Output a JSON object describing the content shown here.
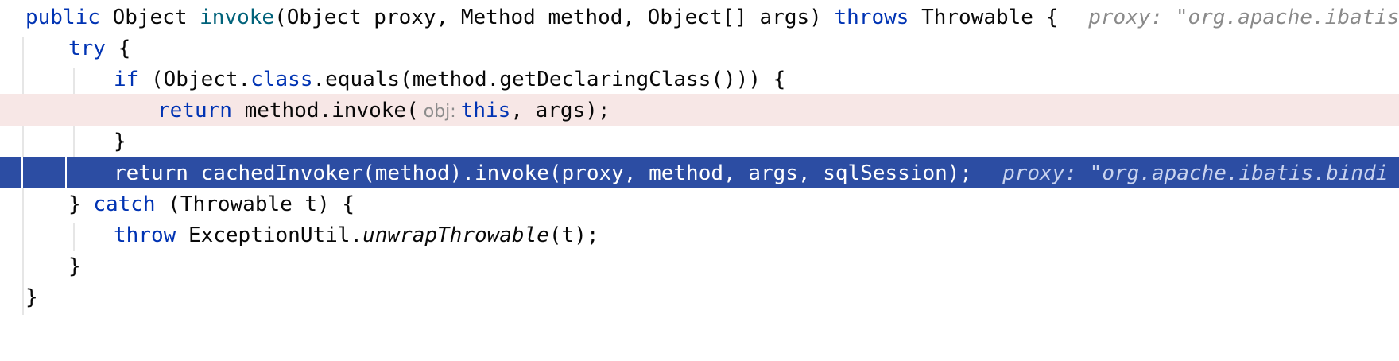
{
  "lines": [
    {
      "tokens": [
        "public",
        "Object",
        "invoke",
        "(Object proxy, Method method, Object[] args)",
        "throws",
        "Throwable {"
      ],
      "hint": "proxy: \"org.apache.ibatis"
    },
    {
      "tokens": [
        "try",
        "{"
      ]
    },
    {
      "tokens": [
        "if",
        "(Object.",
        "class",
        ".equals(method.getDeclaringClass())) {"
      ]
    },
    {
      "tokens": [
        "return",
        "method.invoke(",
        "obj:",
        "this",
        ", args);"
      ]
    },
    {
      "tokens": [
        "}"
      ]
    },
    {
      "tokens": [
        "return cachedInvoker(method).invoke(proxy, method, args, sqlSession);"
      ],
      "hint": "proxy: \"org.apache.ibatis.bindi"
    },
    {
      "tokens": [
        "} ",
        "catch",
        "(Throwable t) {"
      ]
    },
    {
      "tokens": [
        "throw",
        "ExceptionUtil.",
        "unwrapThrowable",
        "(t);"
      ]
    },
    {
      "tokens": [
        "}"
      ]
    },
    {
      "tokens": [
        "}"
      ]
    }
  ]
}
